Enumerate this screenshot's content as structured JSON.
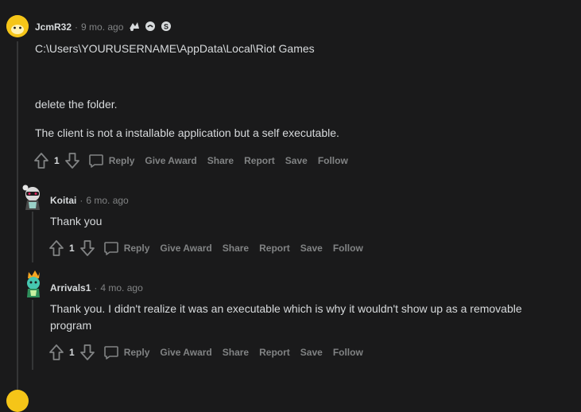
{
  "comments": [
    {
      "username": "JcmR32",
      "separator": "·",
      "time": "9 mo. ago",
      "awards": [
        "wholesome-award-icon",
        "take-my-energy-award-icon",
        "silver-award-icon"
      ],
      "paragraphs": [
        "C:\\Users\\YOURUSERNAME\\AppData\\Local\\Riot Games",
        "delete the folder.",
        "The client is not a installable application but a self executable."
      ],
      "score": "1",
      "actions": [
        "Reply",
        "Give Award",
        "Share",
        "Report",
        "Save",
        "Follow"
      ]
    },
    {
      "username": "Koitai",
      "separator": "·",
      "time": "6 mo. ago",
      "paragraphs": [
        "Thank you"
      ],
      "score": "1",
      "actions": [
        "Reply",
        "Give Award",
        "Share",
        "Report",
        "Save",
        "Follow"
      ]
    },
    {
      "username": "Arrivals1",
      "separator": "·",
      "time": "4 mo. ago",
      "paragraphs": [
        "Thank you. I didn't realize it was an executable which is why it wouldn't show up as a removable program"
      ],
      "score": "1",
      "actions": [
        "Reply",
        "Give Award",
        "Share",
        "Report",
        "Save",
        "Follow"
      ]
    }
  ],
  "colors": {
    "background": "#1a1a1b",
    "text": "#d7dadc",
    "muted": "#818384",
    "thread_line": "#343536"
  }
}
